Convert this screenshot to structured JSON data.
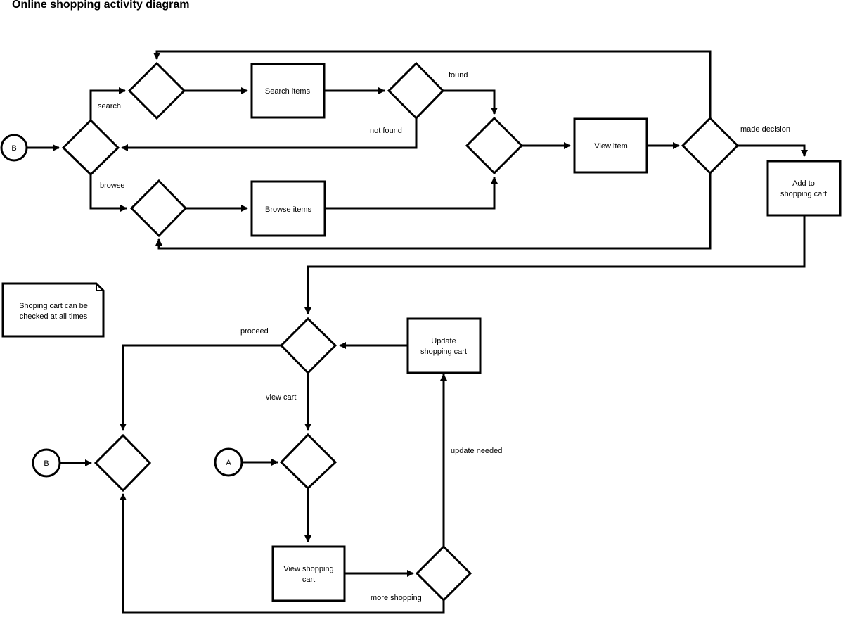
{
  "title": "Online shopping activity diagram",
  "nodes": {
    "b_start": {
      "label": "B"
    },
    "search_items": {
      "label": "Search items"
    },
    "browse_items": {
      "label": "Browse items"
    },
    "view_item": {
      "label": "View item"
    },
    "add_to_cart": {
      "lines": [
        "Add to",
        "shopping cart"
      ]
    },
    "update_cart": {
      "lines": [
        "Update",
        "shopping cart"
      ]
    },
    "view_cart": {
      "lines": [
        "View shopping",
        "cart"
      ]
    },
    "b_end": {
      "label": "B"
    },
    "a_start": {
      "label": "A"
    },
    "note": {
      "lines": [
        "Shoping cart can be",
        "checked at all times"
      ]
    }
  },
  "edge_labels": {
    "search": "search",
    "browse": "browse",
    "found": "found",
    "not_found": "not found",
    "made_decision": "made decision",
    "proceed": "proceed",
    "view_cart": "view cart",
    "update_needed": "update needed",
    "more_shopping": "more shopping"
  }
}
